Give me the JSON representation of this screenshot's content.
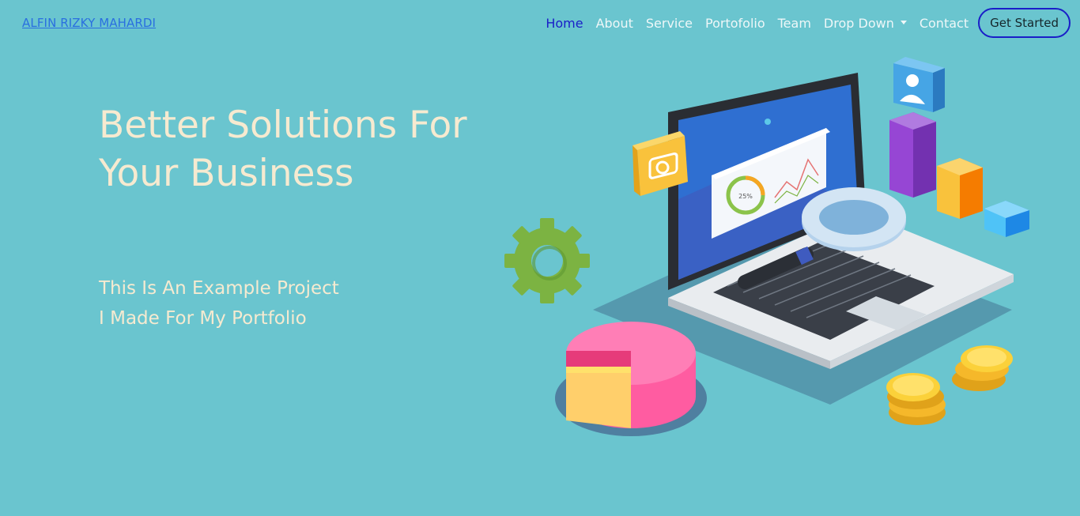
{
  "brand": {
    "label": "ALFIN RIZKY MAHARDI"
  },
  "nav": {
    "items": [
      {
        "label": "Home",
        "active": true
      },
      {
        "label": "About"
      },
      {
        "label": "Service"
      },
      {
        "label": "Portofolio"
      },
      {
        "label": "Team"
      },
      {
        "label": "Drop Down",
        "has_dropdown": true
      },
      {
        "label": "Contact"
      }
    ],
    "cta_label": "Get Started"
  },
  "hero": {
    "title_line1": "Better Solutions For",
    "title_line2": "Your Business",
    "subtitle_line1": "This Is An Example Project",
    "subtitle_line2": "I Made For My Portfolio"
  },
  "illustration": {
    "screen_badge": "25%"
  },
  "colors": {
    "background": "#6ac5cf",
    "brand_link": "#2a6fe0",
    "nav_active": "#1a1ec8",
    "hero_text": "#f6ead0"
  }
}
